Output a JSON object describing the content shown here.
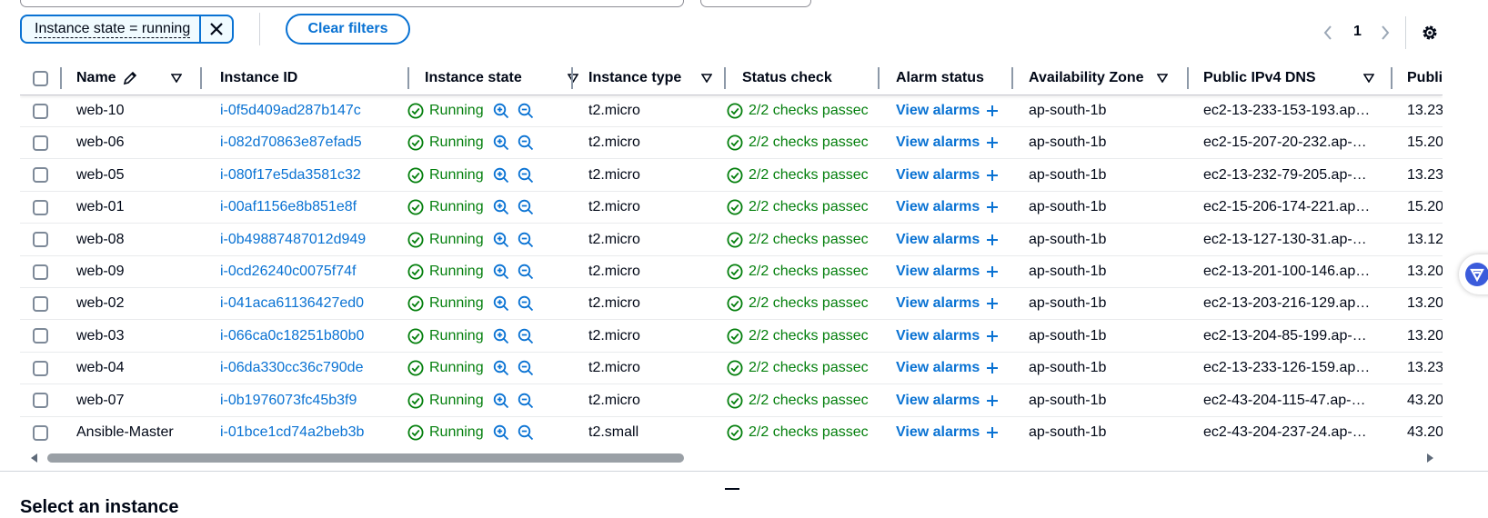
{
  "filter": {
    "token_label": "Instance state = running",
    "clear_label": "Clear filters"
  },
  "pagination": {
    "current_page": "1"
  },
  "table": {
    "columns": [
      "Name",
      "Instance ID",
      "Instance state",
      "Instance type",
      "Status check",
      "Alarm status",
      "Availability Zone",
      "Public IPv4 DNS",
      "Publi"
    ],
    "rows": [
      {
        "name": "web-10",
        "id": "i-0f5d409ad287b147c",
        "state": "Running",
        "type": "t2.micro",
        "status": "2/2 checks passec",
        "alarm": "View alarms",
        "az": "ap-south-1b",
        "dns": "ec2-13-233-153-193.ap…",
        "ip": "13.23"
      },
      {
        "name": "web-06",
        "id": "i-082d70863e87efad5",
        "state": "Running",
        "type": "t2.micro",
        "status": "2/2 checks passec",
        "alarm": "View alarms",
        "az": "ap-south-1b",
        "dns": "ec2-15-207-20-232.ap-…",
        "ip": "15.20"
      },
      {
        "name": "web-05",
        "id": "i-080f17e5da3581c32",
        "state": "Running",
        "type": "t2.micro",
        "status": "2/2 checks passec",
        "alarm": "View alarms",
        "az": "ap-south-1b",
        "dns": "ec2-13-232-79-205.ap-…",
        "ip": "13.23"
      },
      {
        "name": "web-01",
        "id": "i-00af1156e8b851e8f",
        "state": "Running",
        "type": "t2.micro",
        "status": "2/2 checks passec",
        "alarm": "View alarms",
        "az": "ap-south-1b",
        "dns": "ec2-15-206-174-221.ap…",
        "ip": "15.20"
      },
      {
        "name": "web-08",
        "id": "i-0b49887487012d949",
        "state": "Running",
        "type": "t2.micro",
        "status": "2/2 checks passec",
        "alarm": "View alarms",
        "az": "ap-south-1b",
        "dns": "ec2-13-127-130-31.ap-…",
        "ip": "13.12"
      },
      {
        "name": "web-09",
        "id": "i-0cd26240c0075f74f",
        "state": "Running",
        "type": "t2.micro",
        "status": "2/2 checks passec",
        "alarm": "View alarms",
        "az": "ap-south-1b",
        "dns": "ec2-13-201-100-146.ap…",
        "ip": "13.20"
      },
      {
        "name": "web-02",
        "id": "i-041aca61136427ed0",
        "state": "Running",
        "type": "t2.micro",
        "status": "2/2 checks passec",
        "alarm": "View alarms",
        "az": "ap-south-1b",
        "dns": "ec2-13-203-216-129.ap…",
        "ip": "13.20"
      },
      {
        "name": "web-03",
        "id": "i-066ca0c18251b80b0",
        "state": "Running",
        "type": "t2.micro",
        "status": "2/2 checks passec",
        "alarm": "View alarms",
        "az": "ap-south-1b",
        "dns": "ec2-13-204-85-199.ap-…",
        "ip": "13.20"
      },
      {
        "name": "web-04",
        "id": "i-06da330cc36c790de",
        "state": "Running",
        "type": "t2.micro",
        "status": "2/2 checks passec",
        "alarm": "View alarms",
        "az": "ap-south-1b",
        "dns": "ec2-13-233-126-159.ap…",
        "ip": "13.23"
      },
      {
        "name": "web-07",
        "id": "i-0b1976073fc45b3f9",
        "state": "Running",
        "type": "t2.micro",
        "status": "2/2 checks passec",
        "alarm": "View alarms",
        "az": "ap-south-1b",
        "dns": "ec2-43-204-115-47.ap-…",
        "ip": "43.20"
      },
      {
        "name": "Ansible-Master",
        "id": "i-01bce1cd74a2beb3b",
        "state": "Running",
        "type": "t2.small",
        "status": "2/2 checks passec",
        "alarm": "View alarms",
        "az": "ap-south-1b",
        "dns": "ec2-43-204-237-24.ap-…",
        "ip": "43.20"
      }
    ]
  },
  "details_panel": {
    "title": "Select an instance"
  },
  "colors": {
    "link": "#0972d3",
    "success": "#037f0c",
    "text": "#000716"
  }
}
